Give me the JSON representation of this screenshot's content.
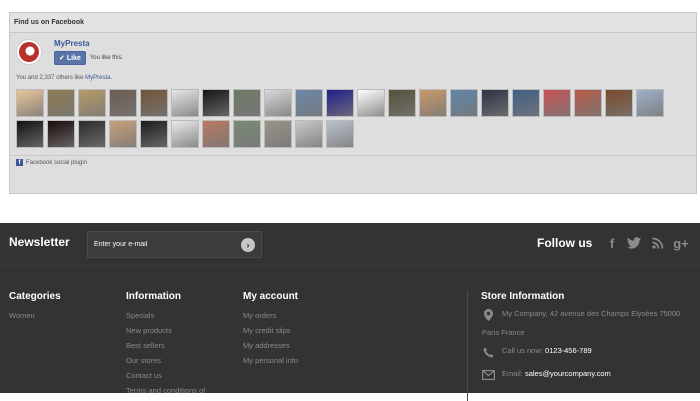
{
  "facebook": {
    "header": "Find us on Facebook",
    "page_name": "MyPresta",
    "like_button": "Like",
    "like_text": "You like this.",
    "count_prefix": "You and 2,337 others like ",
    "count_link": "MyPresta",
    "count_suffix": ".",
    "plugin_label": "Facebook social plugin",
    "faces": [
      "#e8c49a",
      "#8c7a52",
      "#b69a66",
      "#6b5c52",
      "#70543a",
      "#e6e6e6",
      "#151515",
      "#6d7a66",
      "#d8d8d8",
      "#6b87a8",
      "#22208a",
      "#ffffff",
      "#57523a",
      "#c9986a",
      "#5f86a8",
      "#2c3344",
      "#405f87",
      "#c75454",
      "#b55b46",
      "#7a4a2b",
      "#9db1c9",
      "#111111",
      "#1a0a0a",
      "#2d2a2a",
      "#c8a07a",
      "#1c1c1c",
      "#eaeaea",
      "#b97862",
      "#7a8a76",
      "#9a9488",
      "#c8c8c8",
      "#bcc3cd"
    ]
  },
  "newsletter": {
    "title": "Newsletter",
    "placeholder": "Enter your e-mail",
    "follow_title": "Follow us"
  },
  "social_icons": [
    "facebook-icon",
    "twitter-icon",
    "rss-icon",
    "google-plus-icon"
  ],
  "footer": {
    "categories": {
      "title": "Categories",
      "items": [
        "Women"
      ]
    },
    "information": {
      "title": "Information",
      "items": [
        "Specials",
        "New products",
        "Best sellers",
        "Our stores",
        "Contact us",
        "Terms and conditions of"
      ]
    },
    "account": {
      "title": "My account",
      "items": [
        "My orders",
        "My credit slips",
        "My addresses",
        "My personal info"
      ]
    },
    "store": {
      "title": "Store Information",
      "address_line1": "My Company, 42 avenue des Champs Elysées 75000",
      "address_line2": "Paris France",
      "phone_label": "Call us now:",
      "phone": "0123-456-789",
      "email_label": "Email:",
      "email": "sales@yourcompany.com"
    }
  }
}
